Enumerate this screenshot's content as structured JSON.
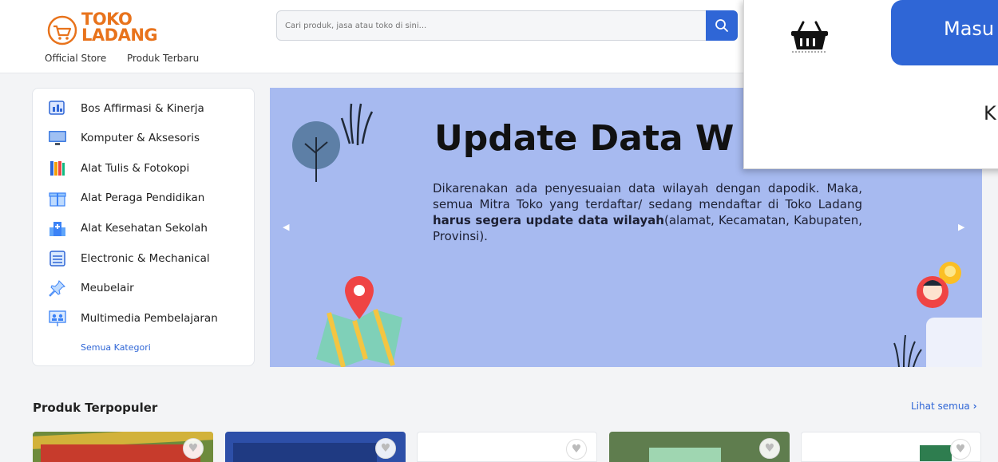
{
  "header": {
    "logo_line1": "TOKO",
    "logo_line2": "LADANG",
    "links": [
      "Official Store",
      "Produk Terbaru"
    ],
    "search_placeholder": "Cari produk, jasa atau toko di sini..."
  },
  "popup": {
    "login_label": "Masu",
    "partial_text": "K"
  },
  "categories": {
    "items": [
      {
        "label": "Bos Affirmasi & Kinerja",
        "icon": "document-chart-icon"
      },
      {
        "label": "Komputer & Aksesoris",
        "icon": "monitor-icon"
      },
      {
        "label": "Alat Tulis & Fotokopi",
        "icon": "books-icon"
      },
      {
        "label": "Alat Peraga Pendidikan",
        "icon": "gift-box-icon"
      },
      {
        "label": "Alat Kesehatan Sekolah",
        "icon": "hospital-icon"
      },
      {
        "label": "Electronic & Mechanical",
        "icon": "server-icon"
      },
      {
        "label": "Meubelair",
        "icon": "pin-icon"
      },
      {
        "label": "Multimedia Pembelajaran",
        "icon": "presentation-icon"
      }
    ],
    "see_all": "Semua Kategori"
  },
  "banner": {
    "title": "Update Data W",
    "body_start": "Dikarenakan ada penyesuaian data wilayah dengan dapodik. Maka, semua Mitra Toko yang terdaftar/ sedang mendaftar di Toko Ladang ",
    "body_bold": "harus segera update data wilayah",
    "body_end": "(alamat, Kecamatan, Kabupaten, Provinsi).",
    "bg_color": "#a7baf0"
  },
  "popular": {
    "title": "Produk Terpopuler",
    "see_all": "Lihat semua",
    "product_count": 5
  },
  "colors": {
    "brand_orange": "#e8731c",
    "primary_blue": "#2f66d6"
  }
}
